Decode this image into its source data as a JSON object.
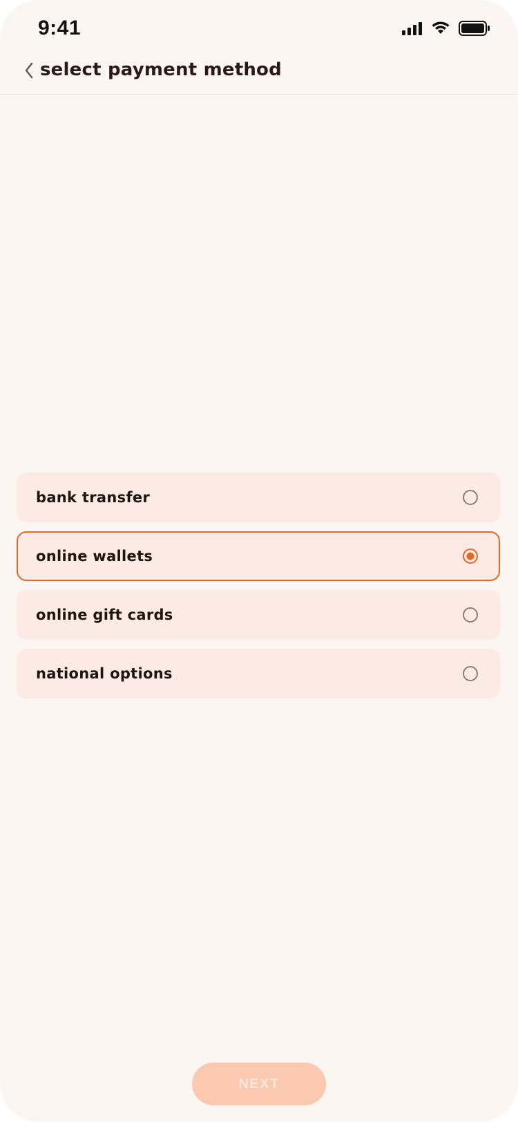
{
  "status_bar": {
    "time": "9:41",
    "icons": [
      "cellular-signal-icon",
      "wifi-icon",
      "battery-icon"
    ]
  },
  "header": {
    "back_icon": "chevron-left-icon",
    "title": "select payment method"
  },
  "options": [
    {
      "label": "bank transfer",
      "selected": false
    },
    {
      "label": "online wallets",
      "selected": true
    },
    {
      "label": "online gift cards",
      "selected": false
    },
    {
      "label": "national options",
      "selected": false
    }
  ],
  "next_button": {
    "label": "NEXT",
    "enabled": false
  },
  "colors": {
    "background": "#fcf6f2",
    "option_background": "#fcebe4",
    "accent": "#e2692a",
    "radio_unselected": "#8a7d78",
    "button_disabled": "#fbc8b0"
  }
}
